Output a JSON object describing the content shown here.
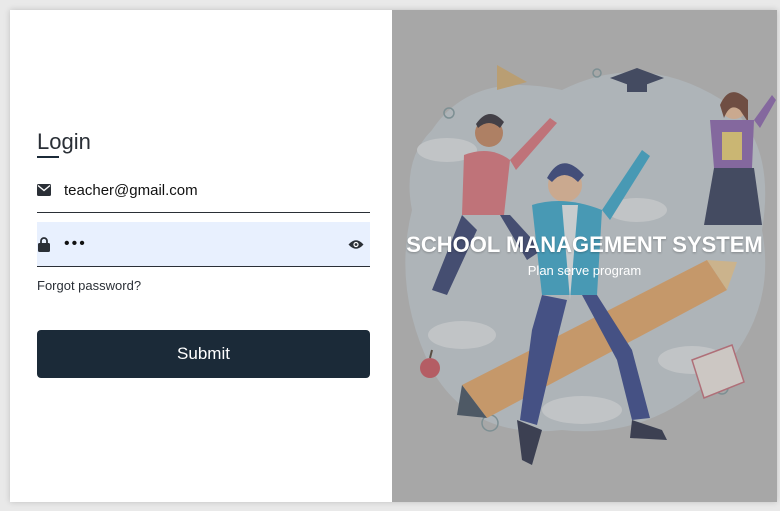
{
  "login": {
    "title": "Login",
    "email_value": "teacher@gmail.com",
    "password_value": "•••",
    "forgot_label": "Forgot password?",
    "submit_label": "Submit"
  },
  "icons": {
    "email": "envelope-icon",
    "password": "lock-icon",
    "toggle": "eye-icon"
  },
  "banner": {
    "title": "SCHOOL MANAGEMENT SYSTEM",
    "subtitle": "Plan serve program"
  },
  "colors": {
    "primary": "#1b2a38",
    "input_fill": "#e8f0fe",
    "banner_bg": "#bdbdbd"
  }
}
